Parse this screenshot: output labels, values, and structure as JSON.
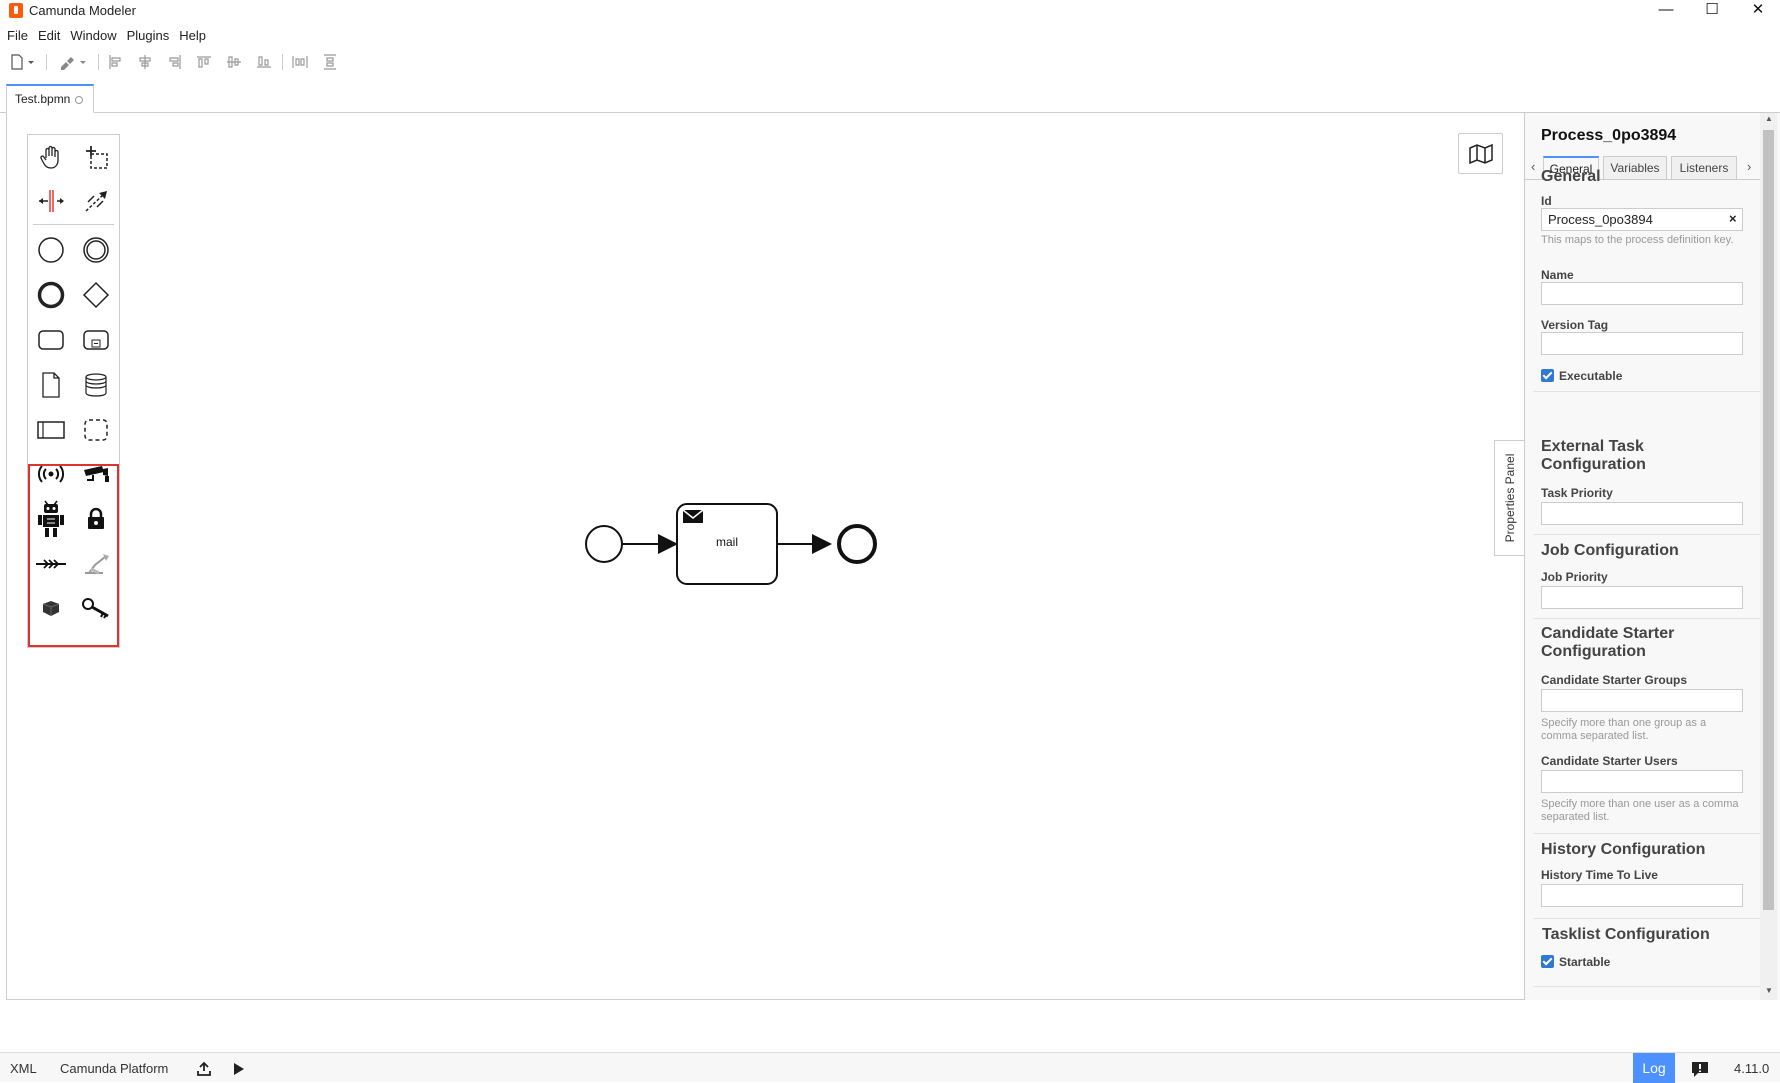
{
  "window": {
    "title": "Camunda Modeler",
    "controls": [
      "—",
      "☐",
      "✕"
    ]
  },
  "menu": [
    "File",
    "Edit",
    "Window",
    "Plugins",
    "Help"
  ],
  "tab": {
    "label": "Test.bpmn"
  },
  "palette": {
    "tools": [
      "hand-tool",
      "lasso-tool",
      "space-tool",
      "global-connect-tool"
    ],
    "elements": [
      "start-event",
      "intermediate-event",
      "end-event",
      "gateway",
      "task",
      "subprocess",
      "data-object",
      "data-store",
      "pool",
      "group"
    ],
    "plugin_elements": [
      "sensor",
      "camera",
      "robot",
      "lock",
      "actuator",
      "robotic-arm",
      "box",
      "key"
    ],
    "highlight_color": "#e03131"
  },
  "diagram": {
    "task_label": "mail",
    "task_type": "send-task"
  },
  "properties": {
    "title": "Process_0po3894",
    "toggle_label": "Properties Panel",
    "tabs": [
      "General",
      "Variables",
      "Listeners"
    ],
    "general": {
      "heading": "General",
      "id_label": "Id",
      "id_value": "Process_0po3894",
      "id_hint": "This maps to the process definition key.",
      "name_label": "Name",
      "name_value": "",
      "version_label": "Version Tag",
      "version_value": "",
      "executable_label": "Executable",
      "executable_checked": true
    },
    "external_task": {
      "heading": "External Task Configuration",
      "priority_label": "Task Priority",
      "priority_value": ""
    },
    "job": {
      "heading": "Job Configuration",
      "priority_label": "Job Priority",
      "priority_value": ""
    },
    "candidate": {
      "heading": "Candidate Starter Configuration",
      "groups_label": "Candidate Starter Groups",
      "groups_hint": "Specify more than one group as a comma separated list.",
      "users_label": "Candidate Starter Users",
      "users_hint": "Specify more than one user as a comma separated list."
    },
    "history": {
      "heading": "History Configuration",
      "ttl_label": "History Time To Live"
    },
    "tasklist": {
      "heading": "Tasklist Configuration",
      "startable_label": "Startable",
      "startable_checked": true
    }
  },
  "statusbar": {
    "xml": "XML",
    "platform": "Camunda Platform",
    "log": "Log",
    "version": "4.11.0"
  },
  "colors": {
    "accent": "#4d90ff",
    "brand": "#fc5d0d",
    "checkbox": "#2f78d4"
  }
}
